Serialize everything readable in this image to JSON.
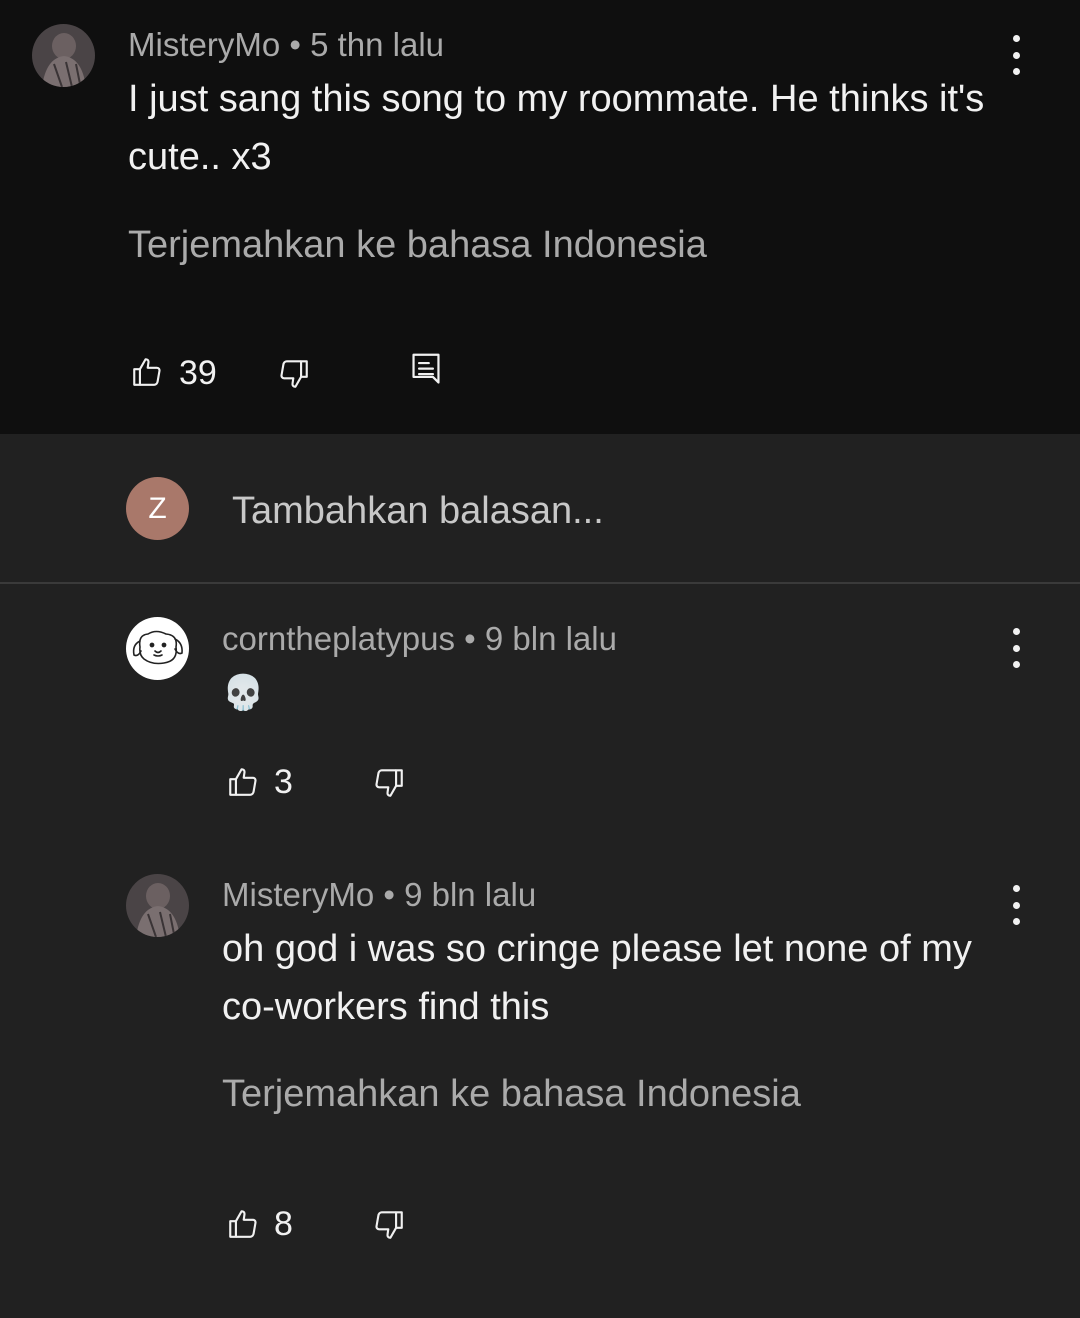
{
  "top_comment": {
    "author": "MisteryMo",
    "time": "• 5 thn lalu",
    "text": "I just sang this song to my roommate. He thinks it's cute.. x3",
    "translate_label": "Terjemahkan ke bahasa Indonesia",
    "likes": "39",
    "icons": [
      "avatar-photo",
      "thumbs-up-icon",
      "thumbs-down-icon",
      "reply-comment-icon",
      "more-options-icon"
    ]
  },
  "reply_box": {
    "avatar_letter": "Z",
    "placeholder": "Tambahkan balasan...",
    "avatar_color": "#a9786a"
  },
  "replies": [
    {
      "author": "corntheplatypus",
      "time": "• 9 bln lalu",
      "text": "💀",
      "likes": "3"
    },
    {
      "author": "MisteryMo",
      "time": "• 9 bln lalu",
      "text": "oh god i was so cringe please let none of my co-workers find this",
      "translate_label": "Terjemahkan ke bahasa Indonesia",
      "likes": "8"
    }
  ],
  "colors": {
    "top_background": "#0f0f0f",
    "replies_background": "#212121",
    "primary_text": "#f1f1f1",
    "secondary_text": "#aaaaaa"
  }
}
